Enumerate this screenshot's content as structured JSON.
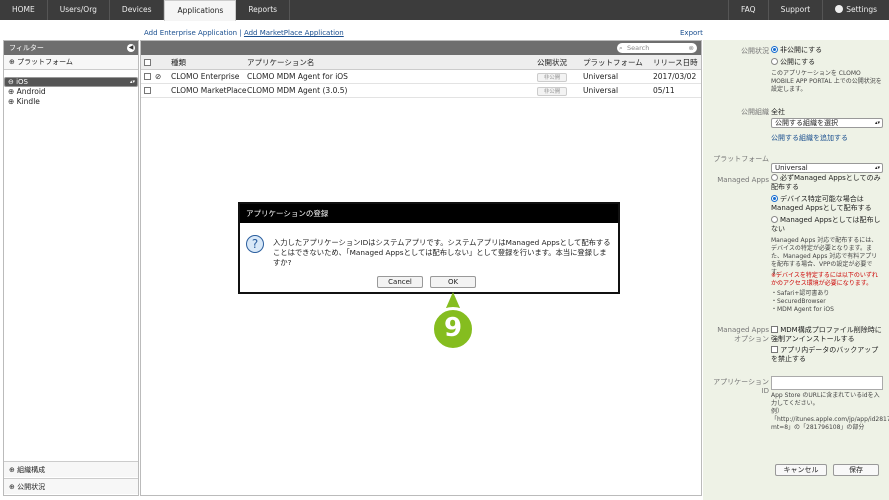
{
  "nav": {
    "tabs": [
      "HOME",
      "Users/Org",
      "Devices",
      "Applications",
      "Reports"
    ],
    "right": [
      "FAQ",
      "Support",
      "Settings"
    ]
  },
  "sidebar": {
    "filter": "フィルター",
    "platform": "プラットフォーム",
    "items": [
      "iOS",
      "Android",
      "Kindle"
    ],
    "org": "組織構成",
    "publish": "公開状況"
  },
  "links": {
    "add_enterprise": "Add Enterprise Application",
    "add_market": "Add MarketPlace Application",
    "export": "Export"
  },
  "search": {
    "placeholder": "Search"
  },
  "table": {
    "headers": [
      "種類",
      "アプリケーション名",
      "公開状況",
      "プラットフォーム",
      "リリース日時"
    ],
    "rows": [
      {
        "type": "CLOMO Enterprise",
        "name": "CLOMO MDM Agent for iOS",
        "status": "非公開",
        "platform": "Universal",
        "date": "2017/03/02"
      },
      {
        "type": "CLOMO MarketPlace",
        "name": "CLOMO MDM Agent (3.0.5)",
        "status": "非公開",
        "platform": "Universal",
        "date": "05/11"
      }
    ]
  },
  "form": {
    "status_label": "公開状況",
    "status_private": "非公開にする",
    "status_public": "公開にする",
    "status_note": "このアプリケーションを CLOMO MOBILE APP PORTAL 上での公開状況を設定します。",
    "org_label": "公開組織",
    "org_value": "全社",
    "org_select": "公開する組織を選択",
    "org_add": "公開する組織を追加する",
    "platform_label": "プラットフォーム",
    "platform_value": "Universal",
    "managed_label": "Managed Apps",
    "managed_opt1": "必ずManaged Appsとしてのみ配布する",
    "managed_opt2": "デバイス特定可能な場合はManaged Appsとして配布する",
    "managed_opt3": "Managed Appsとしては配布しない",
    "managed_note": "Managed Apps 対応で配布するには、デバイスの特定が必要となります。また、Managed Apps 対応で有料アプリを配布する場合、VPPの設定が必要です。",
    "managed_warn": "※デバイスを特定するには以下のいずれかのアクセス環境が必要になります。",
    "managed_env": [
      "・Safari+認可書あり",
      "・SecuredBrowser",
      "・MDM Agent for iOS"
    ],
    "option_label": "Managed Apps オプション",
    "option1": "MDM構成プロファイル削除時に強制アンインストールする",
    "option2": "アプリ内データのバックアップを禁止する",
    "appid_label": "アプリケーション ID",
    "appid_note": "App Store のURLに含まれているidを入力してください。",
    "appid_example": "例）「http://itunes.apple.com/jp/app/id281796108?mt=8」の「281796108」の部分",
    "cancel": "キャンセル",
    "save": "保存"
  },
  "dialog": {
    "title": "アプリケーションの登録",
    "message": "入力したアプリケーションIDはシステムアプリです。システムアプリはManaged Appsとして配布することはできないため、「Managed Appsとしては配布しない」として登録を行います。本当に登録しますか?",
    "cancel": "Cancel",
    "ok": "OK"
  },
  "step": {
    "number": "9",
    "color": "#85bd1f"
  }
}
